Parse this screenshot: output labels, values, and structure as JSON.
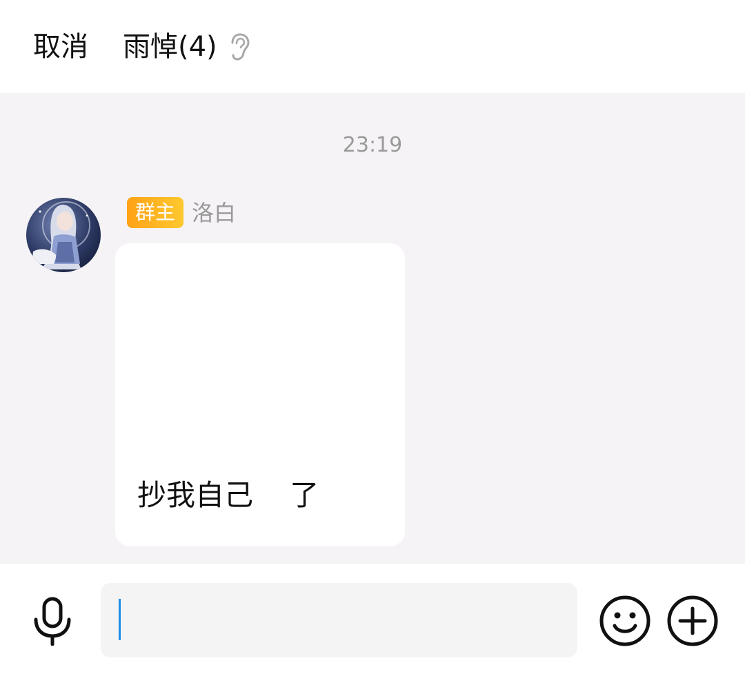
{
  "header": {
    "cancel_label": "取消",
    "title": "雨悼(4)",
    "ear_icon": "ear-icon"
  },
  "chat": {
    "messages": [
      {
        "time": "23:19",
        "sender_badge": "群主",
        "sender_name": "洛白",
        "avatar_icon": "anime-girl-avatar",
        "text": "抄我自己    了"
      }
    ]
  },
  "input_bar": {
    "value": "",
    "mic_icon": "microphone-icon",
    "emoji_icon": "smiley-icon",
    "plus_icon": "plus-circle-icon"
  },
  "colors": {
    "chat_background": "#f5f3f5",
    "badge_gradient_start": "#ffa217",
    "badge_gradient_end": "#ffc82e",
    "caret": "#1a8ee8"
  }
}
